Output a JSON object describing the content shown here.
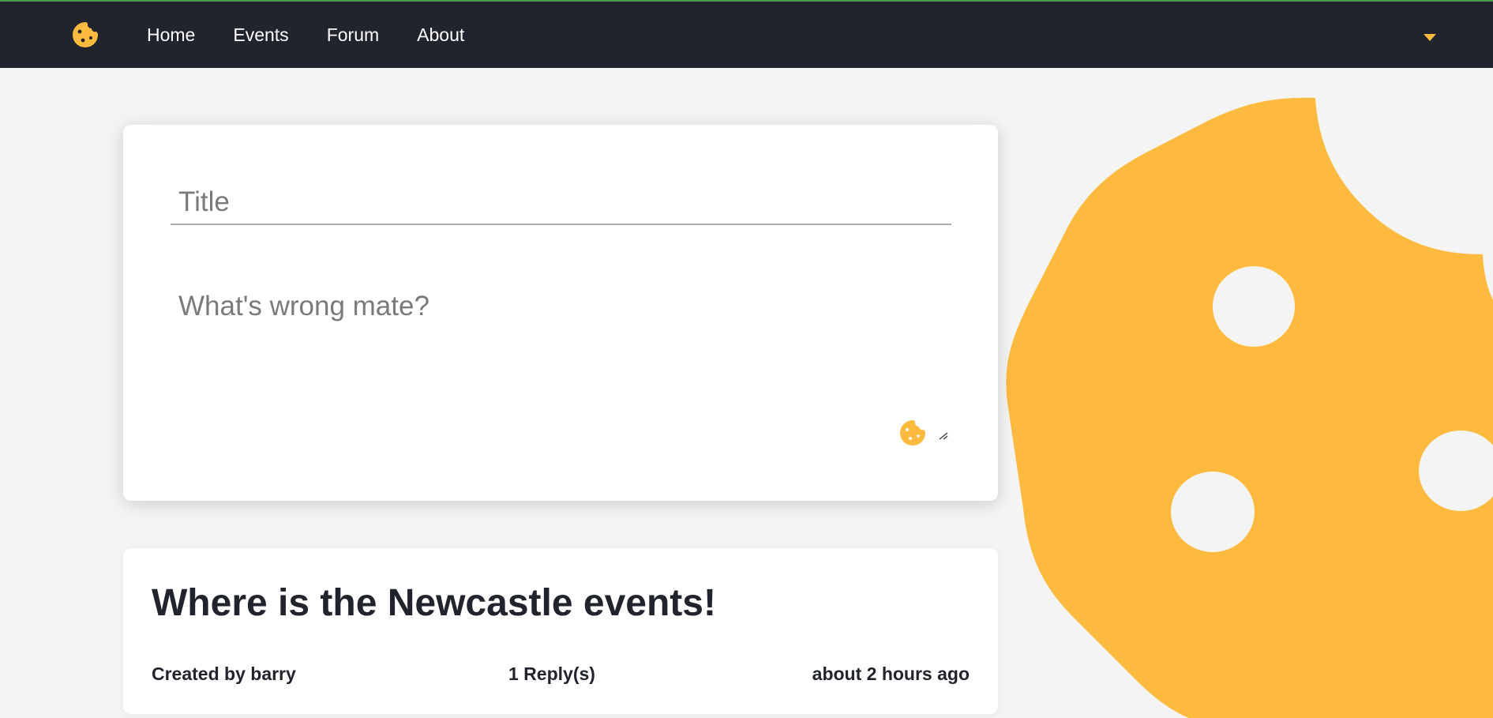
{
  "nav": {
    "logo_icon": "cookie-icon",
    "links": [
      {
        "label": "Home"
      },
      {
        "label": "Events"
      },
      {
        "label": "Forum"
      },
      {
        "label": "About"
      }
    ],
    "dropdown_icon": "caret-down-icon"
  },
  "compose": {
    "title_placeholder": "Title",
    "body_placeholder": "What's wrong mate?",
    "emoji_icon": "cookie-icon"
  },
  "post": {
    "title": "Where is the Newcastle events!",
    "author": "Created by barry",
    "replies": "1 Reply(s)",
    "time": "about 2 hours ago"
  },
  "colors": {
    "navbar": "#21242c",
    "accent": "#fdba3f",
    "background": "#f4f4f4",
    "top_border": "#4c9a4c"
  }
}
